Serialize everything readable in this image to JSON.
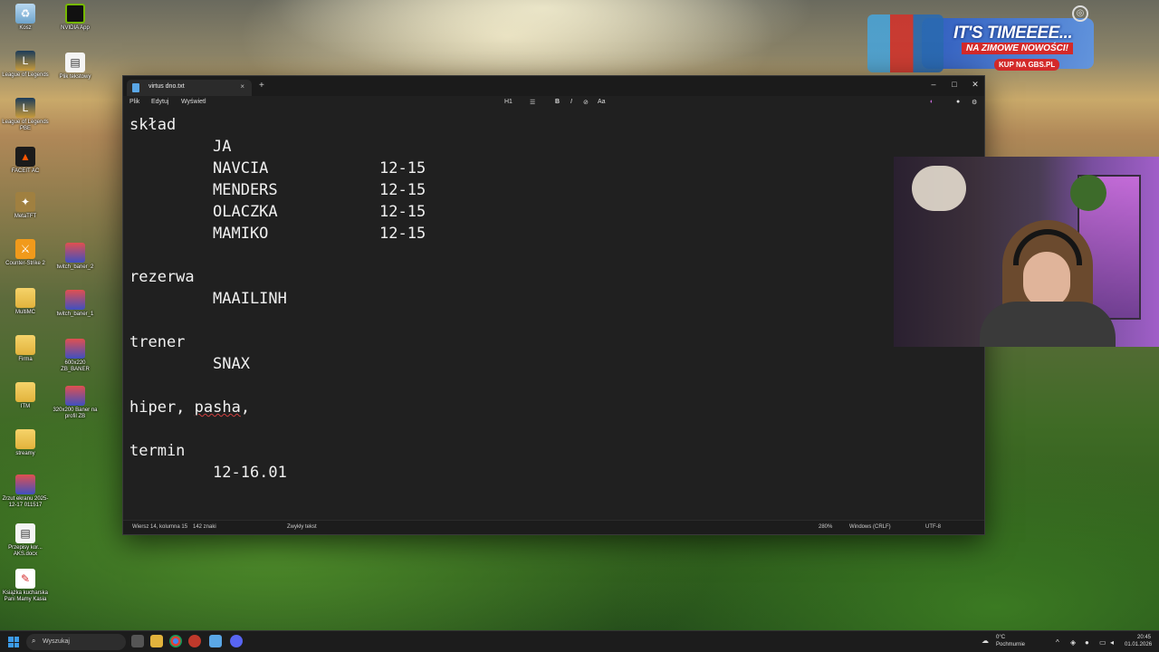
{
  "desktop": {
    "icons_left": [
      {
        "label": "Kosz",
        "icon": "recycle-bin-icon"
      },
      {
        "label": "League of Legends",
        "icon": "league-icon"
      },
      {
        "label": "League of Legends PBE",
        "icon": "league-icon"
      },
      {
        "label": "FACEIT AC",
        "icon": "faceit-icon"
      },
      {
        "label": "MetaTFT",
        "icon": "app-icon"
      },
      {
        "label": "Counter-Strike 2",
        "icon": "cs2-icon"
      },
      {
        "label": "MultiMC",
        "icon": "folder-icon"
      },
      {
        "label": "Firma",
        "icon": "folder-icon"
      },
      {
        "label": "ITM",
        "icon": "folder-icon"
      },
      {
        "label": "streamy",
        "icon": "folder-icon"
      },
      {
        "label": "Zrzut ekranu 2025-12-17 011517",
        "icon": "image-icon"
      },
      {
        "label": "Przepisy kor... AKS.docx",
        "icon": "document-icon"
      },
      {
        "label": "Książka kucharska Pani Mamy Kasia",
        "icon": "pdf-icon"
      }
    ],
    "icons_right": [
      {
        "label": "NVIDIA App",
        "icon": "nvidia-icon"
      },
      {
        "label": "Plik tekstowy",
        "icon": "document-icon"
      },
      {
        "label": "twitch_baner_2",
        "icon": "image-icon"
      },
      {
        "label": "twitch_baner_1",
        "icon": "image-icon"
      },
      {
        "label": "600x220 ZB_BANER",
        "icon": "image-icon"
      },
      {
        "label": "320x200 Baner na profil ZB",
        "icon": "image-icon"
      }
    ]
  },
  "ad": {
    "line1": "IT'S TIMEEEE...",
    "line2": "NA ZIMOWE NOWOŚCI!",
    "line3": "KUP NA GBS.PL"
  },
  "window": {
    "tab_title": "virtus dno.txt",
    "tab_close": "×",
    "new_tab": "+",
    "minimize": "–",
    "maximize": "□",
    "close": "✕",
    "menu": {
      "file": "Plik",
      "edit": "Edytuj",
      "view": "Wyświetl"
    },
    "format": {
      "heading": "H1",
      "list": "☰",
      "bold": "B",
      "italic": "I",
      "link": "⊘",
      "clear": "Aa"
    }
  },
  "document": {
    "l1": "skład",
    "l2": "JA",
    "roster": [
      {
        "name": "NAVCIA",
        "time": "12-15"
      },
      {
        "name": "MENDERS",
        "time": "12-15"
      },
      {
        "name": "OLACZKA",
        "time": "12-15"
      },
      {
        "name": "MAMIKO",
        "time": "12-15"
      }
    ],
    "reserve_label": "rezerwa",
    "reserve_name": "MAAILINH",
    "coach_label": "trener",
    "coach_name": "SNAX",
    "note_a": "hiper, ",
    "note_b": "pasha",
    "note_c": ",",
    "term_label": "termin",
    "term_value": "12-16.01"
  },
  "status": {
    "position": "Wiersz 14, kolumna 15",
    "chars": "142 znaki",
    "mode": "Zwykły tekst",
    "zoom": "280%",
    "eol": "Windows (CRLF)",
    "encoding": "UTF-8"
  },
  "taskbar": {
    "search_placeholder": "Wyszukaj",
    "weather_temp": "0°C",
    "weather_desc": "Pochmurnie",
    "time": "20:45",
    "date": "01.01.2026"
  }
}
